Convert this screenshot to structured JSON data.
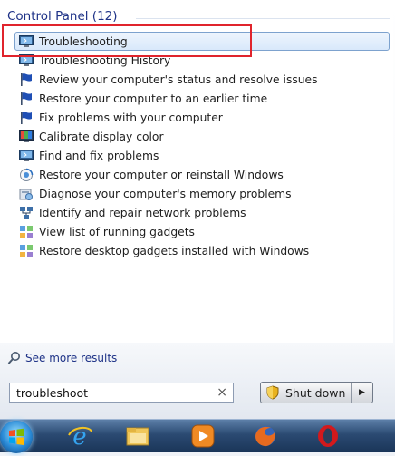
{
  "results": {
    "group_label": "Control Panel (12)",
    "items": [
      {
        "label": "Troubleshooting",
        "icon": "troubleshooting-icon",
        "selected": true
      },
      {
        "label": "Troubleshooting History",
        "icon": "troubleshooting-icon"
      },
      {
        "label": "Review your computer's status and resolve issues",
        "icon": "action-center-flag-icon"
      },
      {
        "label": "Restore your computer to an earlier time",
        "icon": "action-center-flag-icon"
      },
      {
        "label": "Fix problems with your computer",
        "icon": "action-center-flag-icon"
      },
      {
        "label": "Calibrate display color",
        "icon": "display-icon"
      },
      {
        "label": "Find and fix problems",
        "icon": "troubleshooting-icon"
      },
      {
        "label": "Restore your computer or reinstall Windows",
        "icon": "recovery-icon"
      },
      {
        "label": "Diagnose your computer's memory problems",
        "icon": "admin-tools-icon"
      },
      {
        "label": "Identify and repair network problems",
        "icon": "network-icon"
      },
      {
        "label": "View list of running gadgets",
        "icon": "gadgets-icon"
      },
      {
        "label": "Restore desktop gadgets installed with Windows",
        "icon": "gadgets-icon"
      }
    ]
  },
  "see_more": {
    "label": "See more results",
    "icon": "search-icon"
  },
  "search": {
    "value": "troubleshoot",
    "clear_icon": "close-icon"
  },
  "shutdown": {
    "label": "Shut down",
    "icon": "shutdown-shield-icon",
    "arrow_icon": "chevron-right-icon"
  },
  "taskbar": {
    "icons": [
      "windows-start-orb-icon",
      "internet-explorer-icon",
      "windows-explorer-icon",
      "media-player-icon",
      "firefox-icon",
      "opera-icon"
    ]
  },
  "colors": {
    "accent": "#1e3287",
    "highlight_border": "#e0242c",
    "selection_fill": "#d8e8fb"
  }
}
